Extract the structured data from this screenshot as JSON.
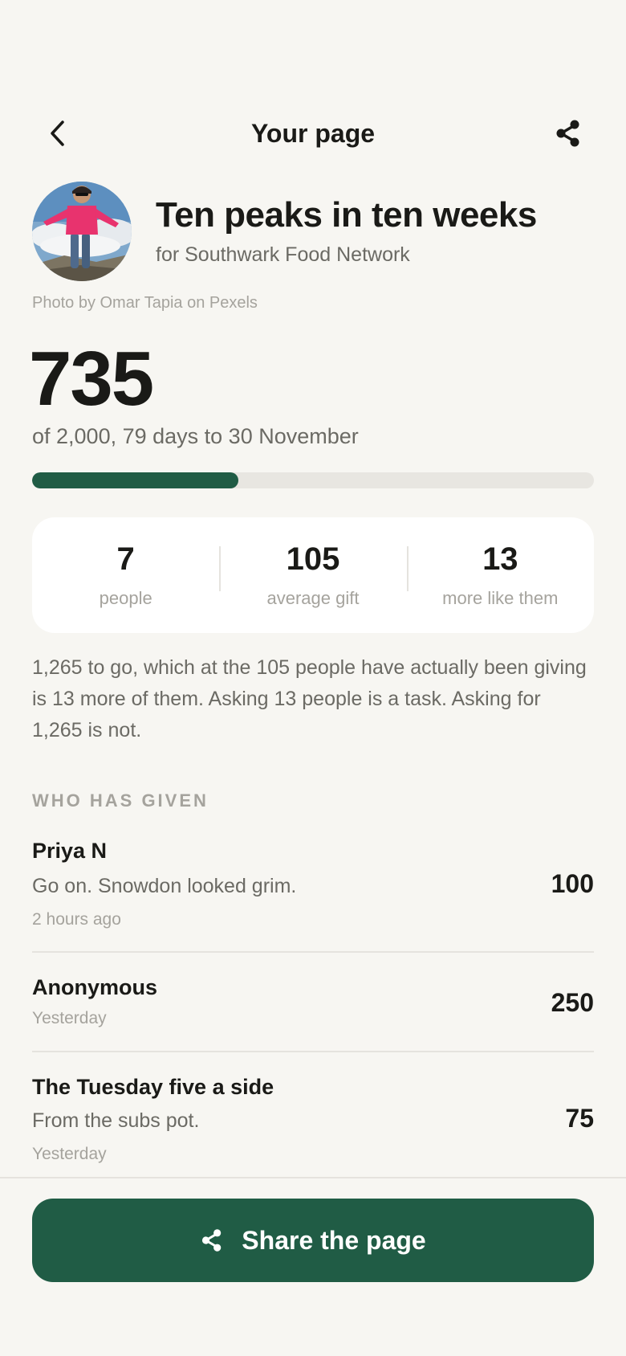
{
  "header": {
    "title": "Your page",
    "back_icon": "chevron-left-icon",
    "share_icon": "share-icon"
  },
  "campaign": {
    "title": "Ten peaks in ten weeks",
    "subtitle": "for Southwark Food Network",
    "photo_credit": "Photo by Omar Tapia on Pexels",
    "total": "735",
    "total_sub": "of 2,000, 79 days to 30 November",
    "progress": 0.3675
  },
  "stats": [
    {
      "value": "7",
      "label": "people"
    },
    {
      "value": "105",
      "label": "average gift"
    },
    {
      "value": "13",
      "label": "more like them"
    }
  ],
  "explainer": "1,265 to go, which at the 105 people have actually been giving is 13 more of them. Asking 13 people is a task. Asking for 1,265 is not.",
  "donors": {
    "heading": "WHO HAS GIVEN",
    "items": [
      {
        "name": "Priya N",
        "message": "Go on. Snowdon looked grim.",
        "time": "2 hours ago",
        "amount": "100"
      },
      {
        "name": "Anonymous",
        "message": "",
        "time": "Yesterday",
        "amount": "250"
      },
      {
        "name": "The Tuesday five a side",
        "message": "From the subs pot.",
        "time": "Yesterday",
        "amount": "75"
      }
    ]
  },
  "share_button": {
    "label": "Share the page"
  },
  "colors": {
    "accent": "#205c45",
    "background": "#f7f6f2",
    "muted_text": "#6b6a64"
  }
}
